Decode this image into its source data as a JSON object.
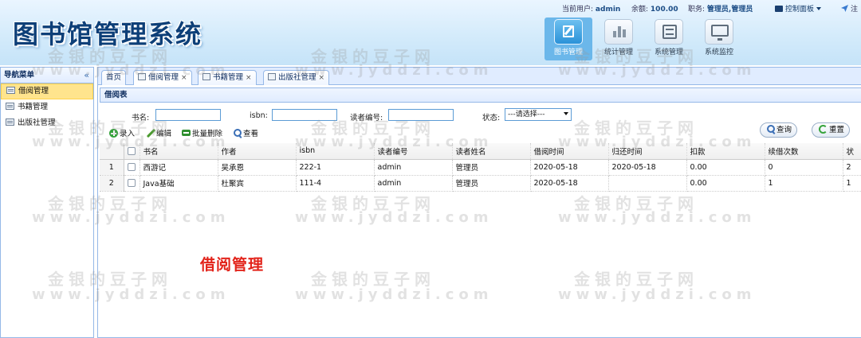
{
  "header": {
    "logo": "图书馆管理系统",
    "current_user_label": "当前用户:",
    "current_user": "admin",
    "balance_label": "余额:",
    "balance": "100.00",
    "role_label": "职务:",
    "role": "管理员,管理员",
    "control_panel": "控制面板",
    "logout": "注",
    "modules": [
      {
        "label": "图书管理",
        "icon": "edit-icon",
        "active": true
      },
      {
        "label": "统计管理",
        "icon": "bar-chart-icon",
        "active": false
      },
      {
        "label": "系统管理",
        "icon": "settings-panel-icon",
        "active": false
      },
      {
        "label": "系统监控",
        "icon": "monitor-icon",
        "active": false
      }
    ]
  },
  "sidebar": {
    "title": "导航菜单",
    "collapse_icon": "«",
    "items": [
      {
        "label": "借阅管理",
        "active": true
      },
      {
        "label": "书籍管理",
        "active": false
      },
      {
        "label": "出版社管理",
        "active": false
      }
    ]
  },
  "tabs": [
    {
      "label": "首页",
      "closable": false
    },
    {
      "label": "借阅管理",
      "closable": true,
      "active": true
    },
    {
      "label": "书籍管理",
      "closable": true
    },
    {
      "label": "出版社管理",
      "closable": true
    }
  ],
  "tab_close": "×",
  "panel": {
    "title": "借阅表",
    "search": {
      "book_name_label": "书名:",
      "isbn_label": "isbn:",
      "reader_id_label": "读者编号:",
      "status_label": "状态:",
      "status_value": "---请选择---"
    },
    "toolbar": {
      "add": "录入",
      "edit": "编辑",
      "batch_delete": "批量删除",
      "view": "查看"
    },
    "query_button": "查询",
    "reset_button": "重置",
    "columns": [
      "书名",
      "作者",
      "isbn",
      "读者编号",
      "读者姓名",
      "借阅时间",
      "归还时间",
      "扣款",
      "续借次数",
      "状"
    ],
    "rows": [
      {
        "num": "1",
        "cells": [
          "西游记",
          "吴承恩",
          "222-1",
          "admin",
          "管理员",
          "2020-05-18",
          "2020-05-18",
          "0.00",
          "0",
          "2"
        ]
      },
      {
        "num": "2",
        "cells": [
          "Java基础",
          "杜聚宾",
          "111-4",
          "admin",
          "管理员",
          "2020-05-18",
          "",
          "0.00",
          "1",
          "1"
        ]
      }
    ]
  },
  "overlay_title": "借阅管理",
  "watermark": {
    "cn": "金银的豆子网",
    "en": "www.jyddzi.com"
  },
  "colors": {
    "accent": "#2b92d8",
    "selected_item": "#ffe48d",
    "border": "#95b8e7",
    "overlay_title": "#e2231a"
  }
}
